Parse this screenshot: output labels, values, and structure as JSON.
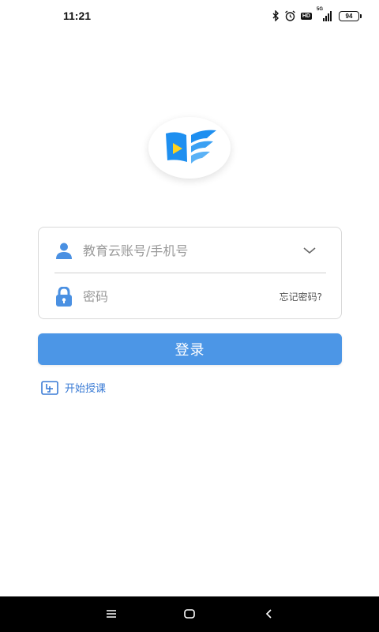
{
  "status_bar": {
    "time": "11:21",
    "icons": [
      "bluetooth-icon",
      "alarm-icon",
      "hd-icon",
      "signal-5g-icon"
    ],
    "hd_label": "HD",
    "network_label": "5G",
    "battery_level": "94"
  },
  "logo": {
    "icon": "book-play-logo",
    "colors": [
      "#1e8ff0",
      "#ffd21f"
    ]
  },
  "login_form": {
    "account_placeholder": "教育云账号/手机号",
    "account_value": "",
    "password_placeholder": "密码",
    "password_value": "",
    "forgot_password": "忘记密码?"
  },
  "login_button": {
    "label": "登录",
    "color": "#4c96e6"
  },
  "start_teaching": {
    "label": "开始授课"
  },
  "nav_bar": {
    "icons": [
      "menu-icon",
      "home-icon",
      "back-icon"
    ]
  }
}
